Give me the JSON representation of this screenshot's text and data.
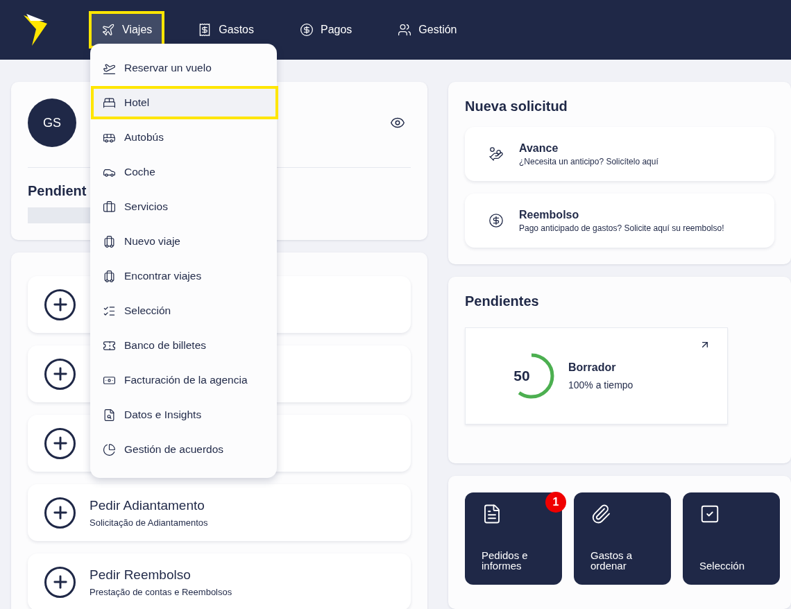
{
  "nav": [
    {
      "label": "Viajes",
      "selected": true
    },
    {
      "label": "Gastos",
      "selected": false
    },
    {
      "label": "Pagos",
      "selected": false
    },
    {
      "label": "Gestión",
      "selected": false
    }
  ],
  "travel_menu": [
    {
      "label": "Reservar un vuelo",
      "selected": false
    },
    {
      "label": "Hotel",
      "selected": true
    },
    {
      "label": "Autobús",
      "selected": false
    },
    {
      "label": "Coche",
      "selected": false
    },
    {
      "label": "Servicios",
      "selected": false
    },
    {
      "label": "Nuevo viaje",
      "selected": false
    },
    {
      "label": "Encontrar viajes",
      "selected": false
    },
    {
      "label": "Selección",
      "selected": false
    },
    {
      "label": "Banco de billetes",
      "selected": false
    },
    {
      "label": "Facturación de la agencia",
      "selected": false
    },
    {
      "label": "Datos e Insights",
      "selected": false
    },
    {
      "label": "Gestión de acuerdos",
      "selected": false
    }
  ],
  "profile": {
    "initials": "GS",
    "pending_title": "Pendient"
  },
  "actions": [
    {
      "kind": "covered"
    },
    {
      "kind": "covered"
    },
    {
      "kind": "covered"
    },
    {
      "kind": "labeled",
      "title": "Pedir Adiantamento",
      "subtitle": "Solicitação de Adiantamentos"
    },
    {
      "kind": "labeled",
      "title": "Pedir Reembolso",
      "subtitle": "Prestação de contas e Reembolsos"
    }
  ],
  "new_request": {
    "title": "Nueva solicitud",
    "items": [
      {
        "title": "Avance",
        "subtitle": "¿Necesita un anticipo? Solicítelo aquí"
      },
      {
        "title": "Reembolso",
        "subtitle": "Pago anticipado de gastos? Solicite aquí su reembolso!"
      }
    ]
  },
  "pending": {
    "title": "Pendientes",
    "cards": [
      {
        "value": "50",
        "title": "Borrador",
        "subtitle": "100% a tiempo",
        "level": 0.6
      }
    ]
  },
  "tiles": [
    {
      "label": "Pedidos e informes",
      "badge": "1"
    },
    {
      "label": "Gastos a ordenar"
    },
    {
      "label": "Selección"
    }
  ]
}
